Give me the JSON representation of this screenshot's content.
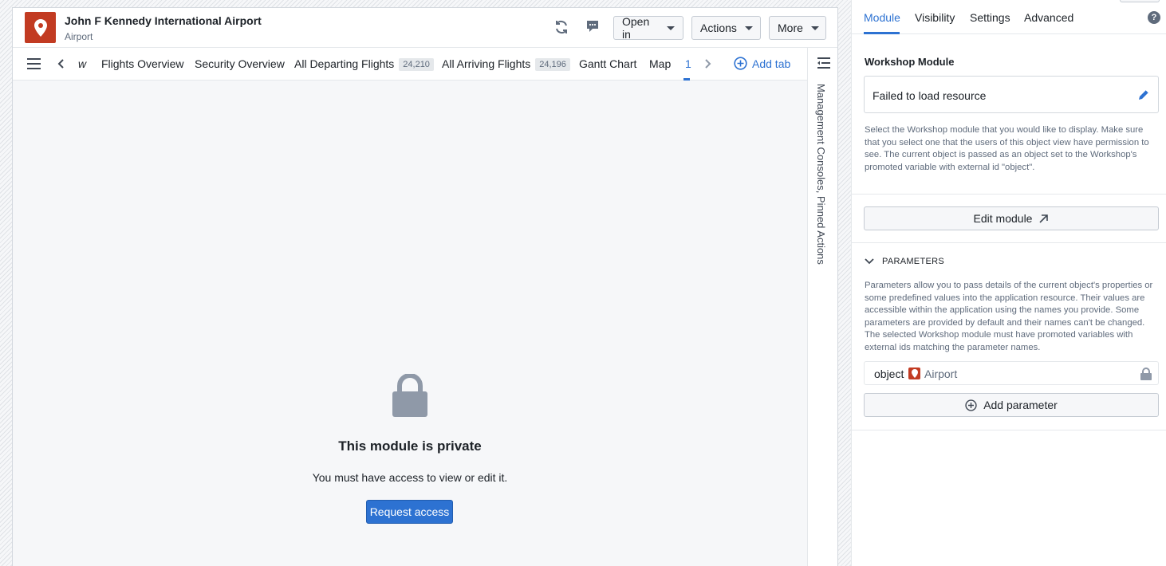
{
  "header": {
    "title": "John F Kennedy International Airport",
    "subtitle": "Airport",
    "buttons": {
      "open_in": "Open in",
      "actions": "Actions",
      "more": "More"
    }
  },
  "tabs": {
    "partial": "w",
    "items": [
      {
        "label": "Flights Overview"
      },
      {
        "label": "Security Overview"
      },
      {
        "label": "All Departing Flights",
        "count": "24,210"
      },
      {
        "label": "All Arriving Flights",
        "count": "24,196"
      },
      {
        "label": "Gantt Chart"
      },
      {
        "label": "Map"
      },
      {
        "label": "1"
      }
    ],
    "add_tab": "Add tab"
  },
  "side_rail": {
    "label": "Management Consoles, Pinned Actions"
  },
  "content": {
    "title": "This module is private",
    "message": "You must have access to view or edit it.",
    "request_button": "Request access"
  },
  "panel": {
    "tabs": [
      "Module",
      "Visibility",
      "Settings",
      "Advanced"
    ],
    "help": "?",
    "section_title": "Workshop Module",
    "resource_text": "Failed to load resource",
    "module_desc": "Select the Workshop module that you would like to display. Make sure that you select one that the users of this object view have permission to see. The current object is passed as an object set to the Workshop's promoted variable with external id \"object\".",
    "edit_button": "Edit module",
    "params_title": "PARAMETERS",
    "params_desc": "Parameters allow you to pass details of the current object's properties or some predefined values into the application resource. Their values are accessible within the application using the names you provide. Some parameters are provided by default and their names can't be changed. The selected Workshop module must have promoted variables with external ids matching the parameter names.",
    "param": {
      "name": "object",
      "type": "Airport"
    },
    "add_param_button": "Add parameter"
  },
  "colors": {
    "accent": "#2d72d2",
    "object_icon": "#c23b22"
  },
  "icons": [
    "map-marker-icon",
    "refresh-icon",
    "comment-icon",
    "menu-icon",
    "chevron-left-icon",
    "chevron-right-icon",
    "add-icon",
    "sidebar-toggle-icon",
    "lock-icon",
    "edit-pencil-icon",
    "arrow-up-right-icon",
    "chevron-down-icon",
    "help-icon"
  ]
}
